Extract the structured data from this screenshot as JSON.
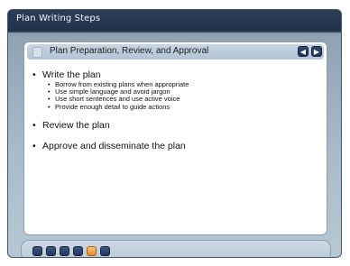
{
  "window": {
    "title": "Plan Writing Steps"
  },
  "section": {
    "title": "Plan Preparation, Review, and Approval",
    "prev_icon": "chevron-left-icon",
    "next_icon": "chevron-right-icon"
  },
  "bullets": [
    {
      "text": "Write the plan",
      "subs": [
        "Borrow from existing plans when appropriate",
        "Use simple language and avoid jargon",
        "Use short sentences and use active voice",
        "Provide enough detail to guide actions"
      ]
    },
    {
      "text": "Review the plan",
      "subs": []
    },
    {
      "text": "Approve and disseminate the plan",
      "subs": []
    }
  ],
  "toolbar": {
    "buttons": [
      {
        "icon": "help-icon"
      },
      {
        "icon": "glossary-icon"
      },
      {
        "icon": "resources-icon"
      },
      {
        "icon": "notes-icon"
      },
      {
        "icon": "map-icon",
        "active": true
      },
      {
        "icon": "exit-icon"
      }
    ]
  },
  "colors": {
    "title_bar": "#23324b",
    "nav_button": "#1f3356",
    "active_button": "#e58e2a"
  }
}
